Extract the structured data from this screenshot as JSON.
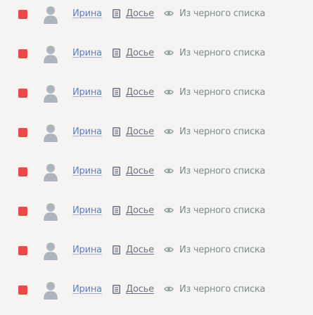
{
  "rows": [
    {
      "name": "Ирина",
      "dossier_label": "Досье",
      "blacklist_label": "Из черного списка",
      "marker_icon": "red-square-icon",
      "avatar_icon": "person-avatar-icon",
      "dossier_icon": "document-icon",
      "blacklist_icon": "eye-icon"
    },
    {
      "name": "Ирина",
      "dossier_label": "Досье",
      "blacklist_label": "Из черного списка",
      "marker_icon": "red-square-icon",
      "avatar_icon": "person-avatar-icon",
      "dossier_icon": "document-icon",
      "blacklist_icon": "eye-icon"
    },
    {
      "name": "Ирина",
      "dossier_label": "Досье",
      "blacklist_label": "Из черного списка",
      "marker_icon": "red-square-icon",
      "avatar_icon": "person-avatar-icon",
      "dossier_icon": "document-icon",
      "blacklist_icon": "eye-icon"
    },
    {
      "name": "Ирина",
      "dossier_label": "Досье",
      "blacklist_label": "Из черного списка",
      "marker_icon": "red-square-icon",
      "avatar_icon": "person-avatar-icon",
      "dossier_icon": "document-icon",
      "blacklist_icon": "eye-icon"
    },
    {
      "name": "Ирина",
      "dossier_label": "Досье",
      "blacklist_label": "Из черного списка",
      "marker_icon": "red-square-icon",
      "avatar_icon": "person-avatar-icon",
      "dossier_icon": "document-icon",
      "blacklist_icon": "eye-icon"
    },
    {
      "name": "Ирина",
      "dossier_label": "Досье",
      "blacklist_label": "Из черного списка",
      "marker_icon": "red-square-icon",
      "avatar_icon": "person-avatar-icon",
      "dossier_icon": "document-icon",
      "blacklist_icon": "eye-icon"
    },
    {
      "name": "Ирина",
      "dossier_label": "Досье",
      "blacklist_label": "Из черного списка",
      "marker_icon": "red-square-icon",
      "avatar_icon": "person-avatar-icon",
      "dossier_icon": "document-icon",
      "blacklist_icon": "eye-icon"
    },
    {
      "name": "Ирина",
      "dossier_label": "Досье",
      "blacklist_label": "Из черного списка",
      "marker_icon": "red-square-icon",
      "avatar_icon": "person-avatar-icon",
      "dossier_icon": "document-icon",
      "blacklist_icon": "eye-icon"
    }
  ],
  "colors": {
    "background": "#f5f4f2",
    "marker": "#e84a4a",
    "avatar": "#aeb5bd",
    "name_link": "#5d7fb8",
    "dossier_text": "#6b7280",
    "blacklist_text": "#7f8c8d"
  }
}
